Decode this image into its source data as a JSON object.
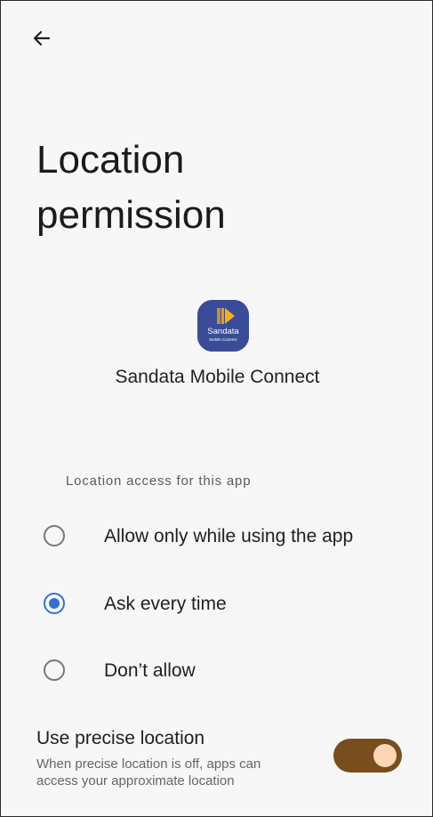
{
  "header": {
    "back_icon": "arrow-left-icon",
    "title_line1": "Location",
    "title_line2": "permission"
  },
  "app": {
    "name": "Sandata Mobile Connect",
    "icon_text_main": "Sandata",
    "icon_text_sub": "Mobile Connect",
    "icon_bg_color": "#3a4c98",
    "icon_accent_color": "#f2b21b"
  },
  "location_access": {
    "header": "Location access for this app",
    "options": [
      {
        "label": "Allow only while using the app",
        "selected": false
      },
      {
        "label": "Ask every time",
        "selected": true
      },
      {
        "label": "Don’t allow",
        "selected": false
      }
    ]
  },
  "precise_location": {
    "title": "Use precise location",
    "description": "When precise location is off, apps can access your approximate location",
    "enabled": true,
    "toggle_color": "#7a4d1d",
    "thumb_color": "#ffd6b3"
  },
  "colors": {
    "radio_selected": "#3471d7",
    "background": "#f7f7f7"
  }
}
